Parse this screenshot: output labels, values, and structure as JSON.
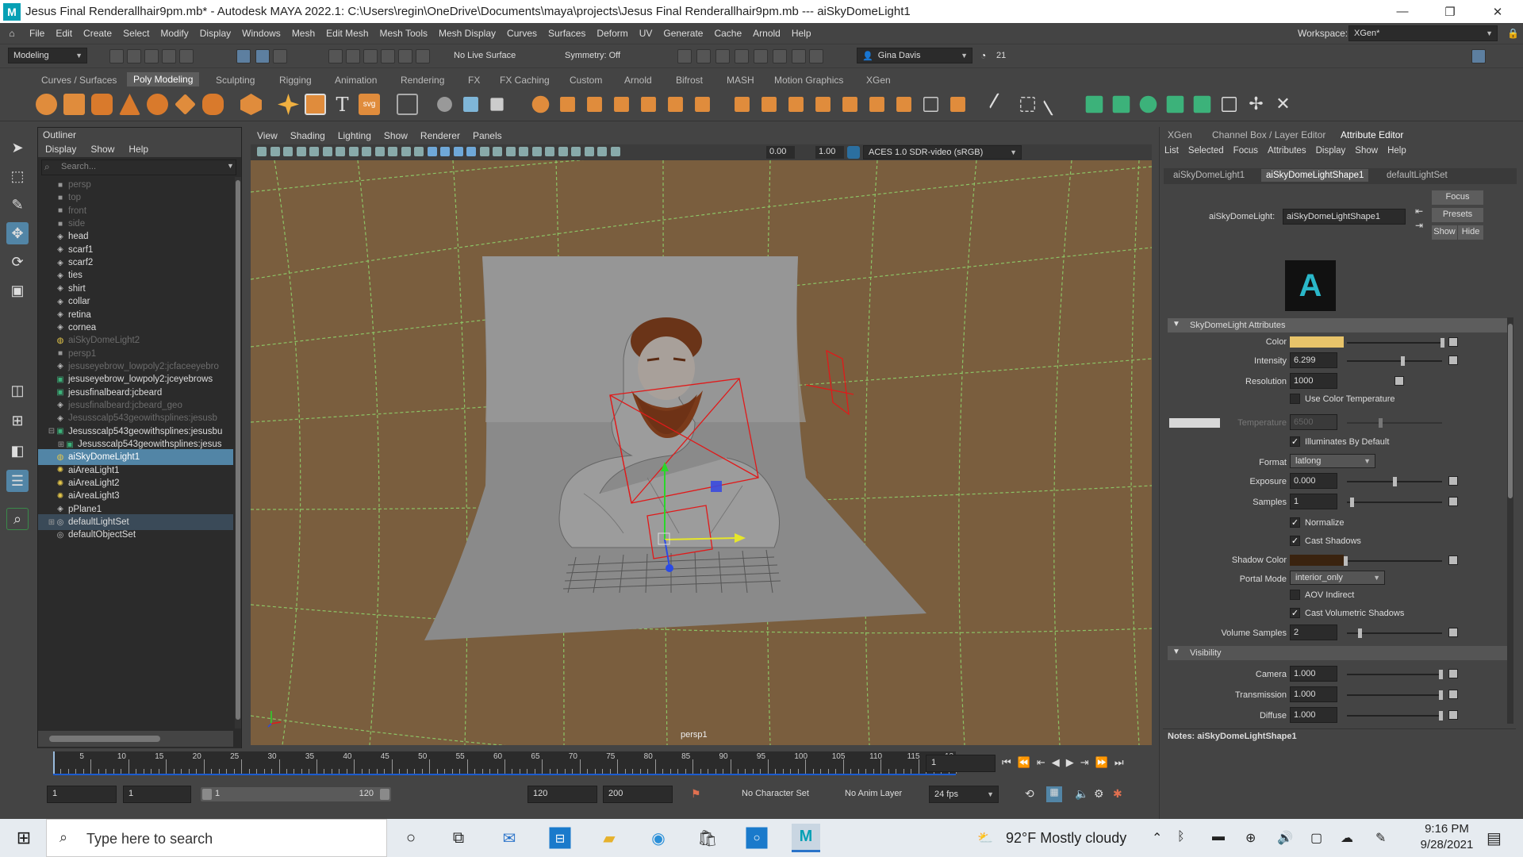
{
  "titlebar": {
    "title": "Jesus Final Renderallhair9pm.mb* - Autodesk MAYA 2022.1: C:\\Users\\regin\\OneDrive\\Documents\\maya\\projects\\Jesus Final Renderallhair9pm.mb   ---   aiSkyDomeLight1",
    "logo": "M",
    "minimize": "—",
    "restore": "❐",
    "close": "✕"
  },
  "menubar": {
    "items": [
      "File",
      "Edit",
      "Create",
      "Select",
      "Modify",
      "Display",
      "Windows",
      "Mesh",
      "Edit Mesh",
      "Mesh Tools",
      "Mesh Display",
      "Curves",
      "Surfaces",
      "Deform",
      "UV",
      "Generate",
      "Cache",
      "Arnold",
      "Help"
    ],
    "workspace_label": "Workspace:",
    "workspace_value": "XGen*"
  },
  "statusline": {
    "menu_set": "Modeling",
    "live_surface": "No Live Surface",
    "symmetry": "Symmetry: Off",
    "user": "Gina Davis",
    "credits": "21"
  },
  "shelf_tabs": [
    "Curves / Surfaces",
    "Poly Modeling",
    "Sculpting",
    "Rigging",
    "Animation",
    "Rendering",
    "FX",
    "FX Caching",
    "Custom",
    "Arnold",
    "Bifrost",
    "MASH",
    "Motion Graphics",
    "XGen"
  ],
  "shelf_active": "Poly Modeling",
  "outliner": {
    "title": "Outliner",
    "menu": [
      "Display",
      "Show",
      "Help"
    ],
    "search_placeholder": "Search...",
    "items": [
      {
        "label": "persp",
        "icon": "camera-icon",
        "dim": true,
        "indent": 0
      },
      {
        "label": "top",
        "icon": "camera-icon",
        "dim": true,
        "indent": 0
      },
      {
        "label": "front",
        "icon": "camera-icon",
        "dim": true,
        "indent": 0
      },
      {
        "label": "side",
        "icon": "camera-icon",
        "dim": true,
        "indent": 0
      },
      {
        "label": "head",
        "icon": "mesh-icon",
        "dim": false,
        "indent": 0
      },
      {
        "label": "scarf1",
        "icon": "mesh-icon",
        "dim": false,
        "indent": 0
      },
      {
        "label": "scarf2",
        "icon": "mesh-icon",
        "dim": false,
        "indent": 0
      },
      {
        "label": "ties",
        "icon": "mesh-icon",
        "dim": false,
        "indent": 0
      },
      {
        "label": "shirt",
        "icon": "mesh-icon",
        "dim": false,
        "indent": 0
      },
      {
        "label": "collar",
        "icon": "mesh-icon",
        "dim": false,
        "indent": 0
      },
      {
        "label": "retina",
        "icon": "mesh-icon",
        "dim": false,
        "indent": 0
      },
      {
        "label": "cornea",
        "icon": "mesh-icon",
        "dim": false,
        "indent": 0
      },
      {
        "label": "aiSkyDomeLight2",
        "icon": "skydome-icon",
        "dim": true,
        "indent": 0
      },
      {
        "label": "persp1",
        "icon": "camera-icon",
        "dim": true,
        "indent": 0
      },
      {
        "label": "jesuseyebrow_lowpoly2:jcfaceeyebro",
        "icon": "mesh-icon",
        "dim": true,
        "indent": 0
      },
      {
        "label": "jesuseyebrow_lowpoly2:jceyebrows",
        "icon": "xgen-icon",
        "dim": false,
        "indent": 0
      },
      {
        "label": "jesusfinalbeard:jcbeard",
        "icon": "xgen-icon",
        "dim": false,
        "indent": 0
      },
      {
        "label": "jesusfinalbeard:jcbeard_geo",
        "icon": "mesh-icon",
        "dim": true,
        "indent": 0
      },
      {
        "label": "Jesusscalp543geowithsplines:jesusb",
        "icon": "mesh-icon",
        "dim": true,
        "indent": 0
      },
      {
        "label": "Jesusscalp543geowithsplines:jesusbu",
        "icon": "xgen-icon",
        "dim": false,
        "indent": 0,
        "expand": "⊟"
      },
      {
        "label": "Jesusscalp543geowithsplines:jesus",
        "icon": "xgen-icon",
        "dim": false,
        "indent": 1,
        "expand": "⊞"
      },
      {
        "label": "aiSkyDomeLight1",
        "icon": "skydome-icon",
        "dim": false,
        "indent": 0,
        "selected": true
      },
      {
        "label": "aiAreaLight1",
        "icon": "arealight-icon",
        "dim": false,
        "indent": 0
      },
      {
        "label": "aiAreaLight2",
        "icon": "arealight-icon",
        "dim": false,
        "indent": 0
      },
      {
        "label": "aiAreaLight3",
        "icon": "arealight-icon",
        "dim": false,
        "indent": 0
      },
      {
        "label": "pPlane1",
        "icon": "mesh-icon",
        "dim": false,
        "indent": 0
      },
      {
        "label": "defaultLightSet",
        "icon": "set-icon",
        "dim": false,
        "indent": 0,
        "expand": "⊞",
        "highlight": true
      },
      {
        "label": "defaultObjectSet",
        "icon": "set-icon",
        "dim": false,
        "indent": 0
      }
    ]
  },
  "viewport": {
    "menu": [
      "View",
      "Shading",
      "Lighting",
      "Show",
      "Renderer",
      "Panels"
    ],
    "near_value": "0.00",
    "far_value": "1.00",
    "colorspace": "ACES 1.0 SDR-video (sRGB)",
    "camera_label": "persp1",
    "ground_color": "#7a5e3e",
    "grid_color": "#8fcf6a"
  },
  "timeline": {
    "ticks": [
      "5",
      "10",
      "15",
      "20",
      "25",
      "30",
      "35",
      "40",
      "45",
      "50",
      "55",
      "60",
      "65",
      "70",
      "75",
      "80",
      "85",
      "90",
      "95",
      "100",
      "105",
      "110",
      "115",
      "12"
    ],
    "current_frame": "1"
  },
  "rangebar": {
    "start": "1",
    "anim_start": "1",
    "range_start": "1",
    "range_end": "120",
    "anim_end": "120",
    "end": "200",
    "character_set": "No Character Set",
    "anim_layer": "No Anim Layer",
    "fps": "24 fps"
  },
  "rightpanel": {
    "tabs": [
      "XGen",
      "Channel Box / Layer Editor",
      "Attribute Editor"
    ],
    "active_tab": "Attribute Editor",
    "menu": [
      "List",
      "Selected",
      "Focus",
      "Attributes",
      "Display",
      "Show",
      "Help"
    ],
    "node_tabs": [
      "aiSkyDomeLight1",
      "aiSkyDomeLightShape1",
      "defaultLightSet"
    ],
    "active_node_tab": "aiSkyDomeLightShape1",
    "node_label": "aiSkyDomeLight:",
    "node_value": "aiSkyDomeLightShape1",
    "focus_btn": "Focus",
    "presets_btn": "Presets",
    "show_btn": "Show",
    "hide_btn": "Hide",
    "logo_letter": "A",
    "section1": "SkyDomeLight Attributes",
    "attrs": {
      "color_label": "Color",
      "color_value": "#e8c46a",
      "intensity_label": "Intensity",
      "intensity_value": "6.299",
      "resolution_label": "Resolution",
      "resolution_value": "1000",
      "use_color_temp": "Use Color Temperature",
      "temperature_label": "Temperature",
      "temperature_value": "6500",
      "illuminates": "Illuminates By Default",
      "format_label": "Format",
      "format_value": "latlong",
      "exposure_label": "Exposure",
      "exposure_value": "0.000",
      "samples_label": "Samples",
      "samples_value": "1",
      "normalize": "Normalize",
      "cast_shadows": "Cast Shadows",
      "shadow_color_label": "Shadow Color",
      "shadow_color_value": "#3a230f",
      "portal_label": "Portal Mode",
      "portal_value": "interior_only",
      "aov_indirect": "AOV Indirect",
      "cast_volumetric": "Cast Volumetric Shadows",
      "volume_samples_label": "Volume Samples",
      "volume_samples_value": "2"
    },
    "section2": "Visibility",
    "visibility": {
      "camera_label": "Camera",
      "camera_value": "1.000",
      "transmission_label": "Transmission",
      "transmission_value": "1.000",
      "diffuse_label": "Diffuse",
      "diffuse_value": "1.000"
    },
    "notes": "Notes:  aiSkyDomeLightShape1"
  },
  "taskbar": {
    "search_placeholder": "Type here to search",
    "weather": "92°F  Mostly cloudy",
    "time": "9:16 PM",
    "date": "9/28/2021"
  }
}
